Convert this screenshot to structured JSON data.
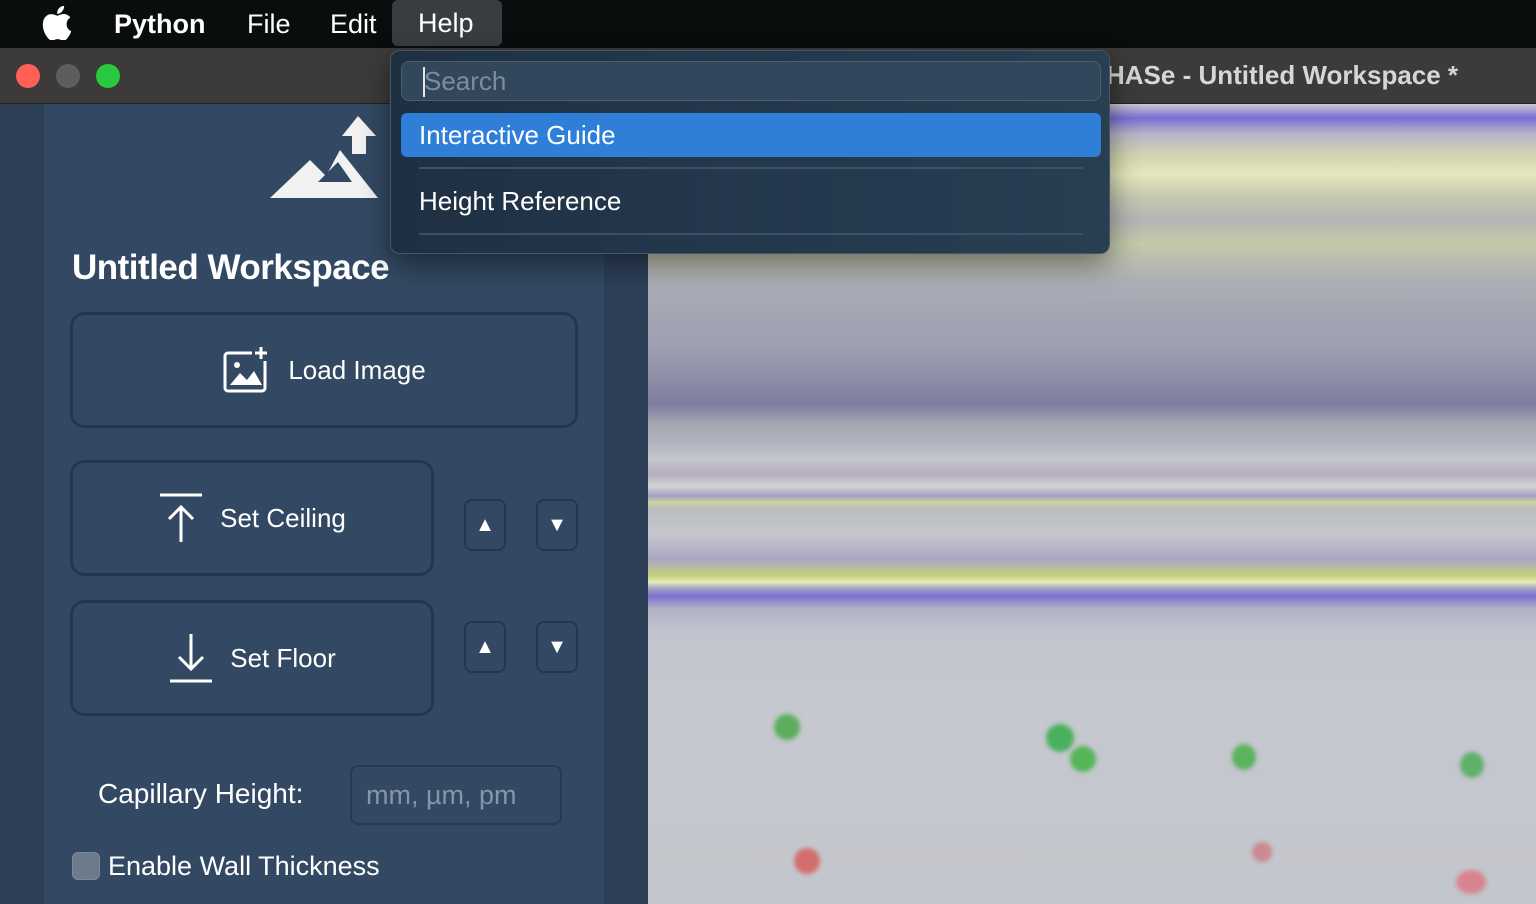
{
  "menubar": {
    "app_name": "Python",
    "items": [
      "File",
      "Edit",
      "Help"
    ],
    "active_item": "Help"
  },
  "window": {
    "title": "HASe - Untitled Workspace *"
  },
  "help_menu": {
    "search_placeholder": "Search",
    "items": [
      {
        "label": "Interactive Guide",
        "selected": true
      },
      {
        "label": "Height Reference",
        "selected": false
      }
    ]
  },
  "sidebar": {
    "workspace_title": "Untitled Workspace",
    "load_image_label": "Load Image",
    "set_ceiling_label": "Set Ceiling",
    "set_floor_label": "Set Floor",
    "up_arrow": "▲",
    "down_arrow": "▼",
    "capillary_height_label": "Capillary Height:",
    "capillary_height_placeholder": "mm, µm, pm",
    "capillary_height_value": "",
    "wall_thickness_label": "Enable Wall Thickness",
    "wall_thickness_checked": false
  },
  "colors": {
    "menu_selection": "#2f7fd8",
    "panel_bg": "#334963",
    "close": "#ff5f57",
    "maximize": "#28c840"
  }
}
